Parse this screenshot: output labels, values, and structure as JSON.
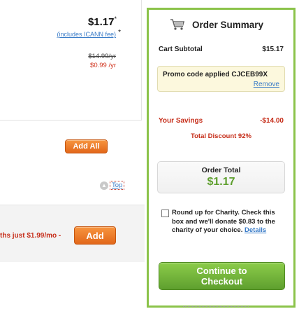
{
  "product": {
    "price": "$1.17",
    "price_marker": "*",
    "icann_note": "(includes ICANN fee)",
    "icann_star": "*",
    "old_price": "$14.99/yr",
    "new_price": "$0.99 /yr"
  },
  "actions": {
    "add_all_label": "Add All",
    "top_link_label": "Top",
    "top_icon_glyph": "▲"
  },
  "addon": {
    "text": "ths just $1.99/mo -",
    "add_label": "Add"
  },
  "summary": {
    "title": "Order Summary",
    "cart_subtotal_label": "Cart Subtotal",
    "cart_subtotal_value": "$15.17",
    "promo_text": "Promo code applied  CJCEB99X",
    "promo_remove": "Remove",
    "savings_label": "Your Savings",
    "savings_value": "-$14.00",
    "total_discount": "Total Discount 92%",
    "order_total_label": "Order Total",
    "order_total_value": "$1.17",
    "charity_text": "Round up for Charity. Check this box and we'll donate $0.83 to the charity of your choice.",
    "charity_details": "Details",
    "checkout_line1": "Continue to",
    "checkout_line2": "Checkout"
  },
  "icons": {
    "cart": "shopping-cart-icon",
    "top": "up-arrow-icon"
  },
  "colors": {
    "accent_green": "#8bc34a",
    "total_green": "#5e9f2e",
    "savings_red": "#c62d19",
    "button_orange": "#f08a30",
    "link_blue": "#3a7cc8"
  }
}
